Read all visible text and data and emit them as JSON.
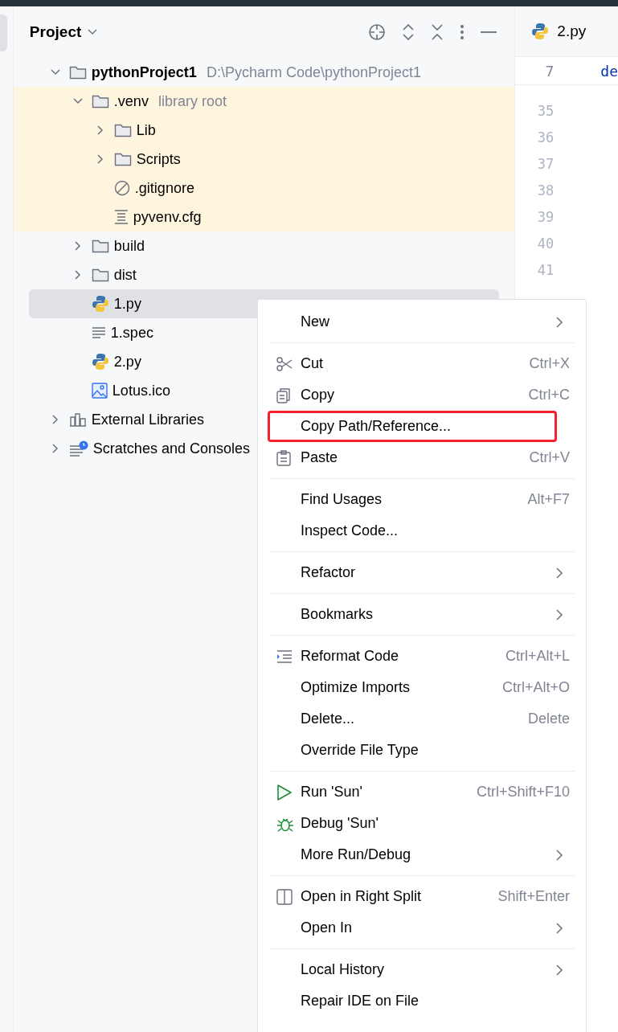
{
  "panel": {
    "title": "Project"
  },
  "tree": [
    {
      "label": "pythonProject1",
      "path": "D:\\Pycharm Code\\pythonProject1",
      "kind": "folder",
      "expanded": true,
      "bold": true,
      "selected": false,
      "children": [
        {
          "label": ".venv",
          "hint": "library root",
          "kind": "folder",
          "expanded": true,
          "highlighted": true,
          "selected": false,
          "children": [
            {
              "label": "Lib",
              "kind": "folder",
              "expanded": false,
              "selected": false
            },
            {
              "label": "Scripts",
              "kind": "folder",
              "expanded": false,
              "selected": false
            },
            {
              "label": ".gitignore",
              "kind": "ignore",
              "selected": false
            },
            {
              "label": "pyvenv.cfg",
              "kind": "config",
              "selected": false
            }
          ]
        },
        {
          "label": "build",
          "kind": "folder",
          "expanded": false,
          "selected": false
        },
        {
          "label": "dist",
          "kind": "folder",
          "expanded": false,
          "selected": false
        },
        {
          "label": "1.py",
          "kind": "python",
          "selected": true
        },
        {
          "label": "1.spec",
          "kind": "text",
          "selected": false
        },
        {
          "label": "2.py",
          "kind": "python",
          "selected": false
        },
        {
          "label": "Lotus.ico",
          "kind": "image",
          "selected": false
        }
      ]
    },
    {
      "label": "External Libraries",
      "kind": "libraries",
      "expanded": false,
      "selected": false
    },
    {
      "label": "Scratches and Consoles",
      "kind": "scratches",
      "expanded": false,
      "selected": false
    }
  ],
  "editor": {
    "tab": "2.py",
    "sticky_line": {
      "number": "7",
      "code": "de"
    },
    "line_numbers": [
      "35",
      "36",
      "37",
      "38",
      "39",
      "40",
      "41"
    ]
  },
  "menu": [
    [
      {
        "label": "New",
        "kind": "plain",
        "submenu": true
      }
    ],
    [
      {
        "label": "Cut",
        "kind": "cut",
        "shortcut": "Ctrl+X"
      },
      {
        "label": "Copy",
        "kind": "copy",
        "shortcut": "Ctrl+C"
      },
      {
        "label": "Copy Path/Reference...",
        "kind": "plain",
        "highlighted": true
      },
      {
        "label": "Paste",
        "kind": "paste",
        "shortcut": "Ctrl+V"
      }
    ],
    [
      {
        "label": "Find Usages",
        "kind": "plain",
        "shortcut": "Alt+F7"
      },
      {
        "label": "Inspect Code...",
        "kind": "plain"
      }
    ],
    [
      {
        "label": "Refactor",
        "kind": "plain",
        "submenu": true
      }
    ],
    [
      {
        "label": "Bookmarks",
        "kind": "plain",
        "submenu": true
      }
    ],
    [
      {
        "label": "Reformat Code",
        "kind": "reformat",
        "shortcut": "Ctrl+Alt+L"
      },
      {
        "label": "Optimize Imports",
        "kind": "plain",
        "shortcut": "Ctrl+Alt+O"
      },
      {
        "label": "Delete...",
        "kind": "plain",
        "shortcut": "Delete"
      },
      {
        "label": "Override File Type",
        "kind": "plain"
      }
    ],
    [
      {
        "label": "Run 'Sun'",
        "kind": "run",
        "shortcut": "Ctrl+Shift+F10"
      },
      {
        "label": "Debug 'Sun'",
        "kind": "debug"
      },
      {
        "label": "More Run/Debug",
        "kind": "plain",
        "submenu": true
      }
    ],
    [
      {
        "label": "Open in Right Split",
        "kind": "split",
        "shortcut": "Shift+Enter"
      },
      {
        "label": "Open In",
        "kind": "plain",
        "submenu": true
      }
    ],
    [
      {
        "label": "Local History",
        "kind": "plain",
        "submenu": true
      },
      {
        "label": "Repair IDE on File",
        "kind": "plain"
      }
    ]
  ]
}
